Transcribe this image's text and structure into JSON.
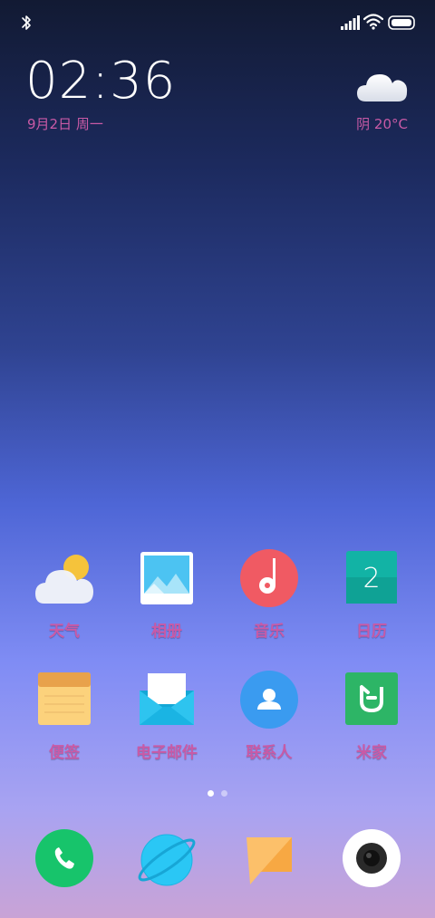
{
  "status_bar": {
    "bluetooth_icon": "bluetooth-icon",
    "signal_icon": "cellular-signal-icon",
    "wifi_icon": "wifi-icon",
    "battery_icon": "battery-icon"
  },
  "clock": {
    "time": "02:36",
    "date": "9月2日 周一"
  },
  "weather": {
    "icon": "cloudy-icon",
    "text": "阴  20°C"
  },
  "home_apps": [
    {
      "label": "天气",
      "icon": "weather-app-icon"
    },
    {
      "label": "相册",
      "icon": "gallery-app-icon"
    },
    {
      "label": "音乐",
      "icon": "music-app-icon"
    },
    {
      "label": "日历",
      "icon": "calendar-app-icon",
      "badge": "2"
    },
    {
      "label": "便签",
      "icon": "notes-app-icon"
    },
    {
      "label": "电子邮件",
      "icon": "email-app-icon"
    },
    {
      "label": "联系人",
      "icon": "contacts-app-icon"
    },
    {
      "label": "米家",
      "icon": "mijia-app-icon"
    }
  ],
  "page_indicator": {
    "pages": 2,
    "current": 1
  },
  "dock": [
    {
      "icon": "phone-app-icon"
    },
    {
      "icon": "browser-app-icon"
    },
    {
      "icon": "messages-app-icon"
    },
    {
      "icon": "camera-app-icon"
    }
  ],
  "colors": {
    "label": "#c95aa6",
    "accent_red": "#f05a63",
    "accent_green": "#17c46b"
  }
}
